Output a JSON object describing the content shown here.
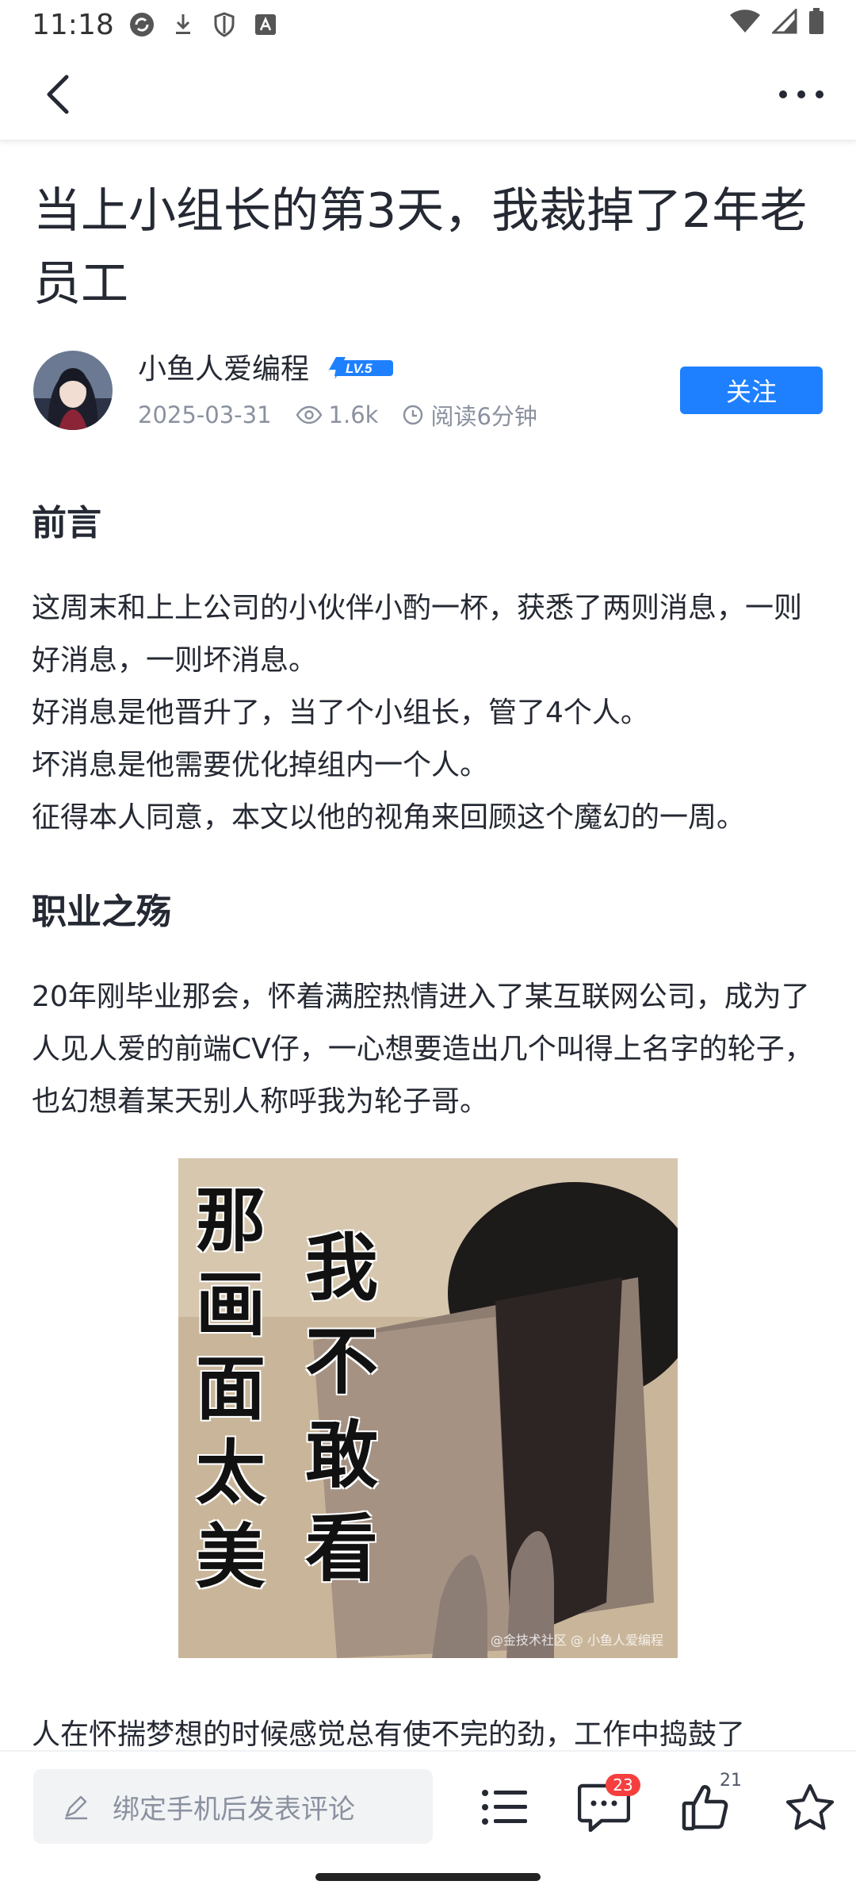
{
  "status": {
    "time": "11:18"
  },
  "article": {
    "title": "当上小组长的第3天，我裁掉了2年老员工",
    "author": {
      "name": "小鱼人爱编程",
      "level": "LV.5",
      "date": "2025-03-31",
      "views": "1.6k",
      "read_time": "阅读6分钟",
      "follow_label": "关注"
    },
    "sections": [
      {
        "heading": "前言",
        "text": "这周末和上上公司的小伙伴小酌一杯，获悉了两则消息，一则好消息，一则坏消息。\n好消息是他晋升了，当了个小组长，管了4个人。\n坏消息是他需要优化掉组内一个人。\n征得本人同意，本文以他的视角来回顾这个魔幻的一周。"
      },
      {
        "heading": "职业之殇",
        "text": "20年刚毕业那会，怀着满腔热情进入了某互联网公司，成为了人见人爱的前端CV仔，一心想要造出几个叫得上名字的轮子，也幻想着某天别人称呼我为轮子哥。"
      }
    ],
    "image": {
      "left_text": "那画面太美",
      "right_text": "我不敢看",
      "watermark": "@金技术社区 @ 小鱼人爱编程"
    },
    "trailing_text": "人在怀揣梦想的时候感觉总有使不完的劲，工作中捣鼓了"
  },
  "bottom_bar": {
    "comment_placeholder": "绑定手机后发表评论",
    "comment_count": "23",
    "like_count": "21"
  },
  "colors": {
    "accent": "#1e80ff",
    "badge": "#f53f3f"
  },
  "icons": [
    "back-arrow-icon",
    "more-icon",
    "pencil-icon",
    "list-icon",
    "comment-icon",
    "thumbs-up-icon",
    "star-icon",
    "eye-icon",
    "clock-icon"
  ]
}
